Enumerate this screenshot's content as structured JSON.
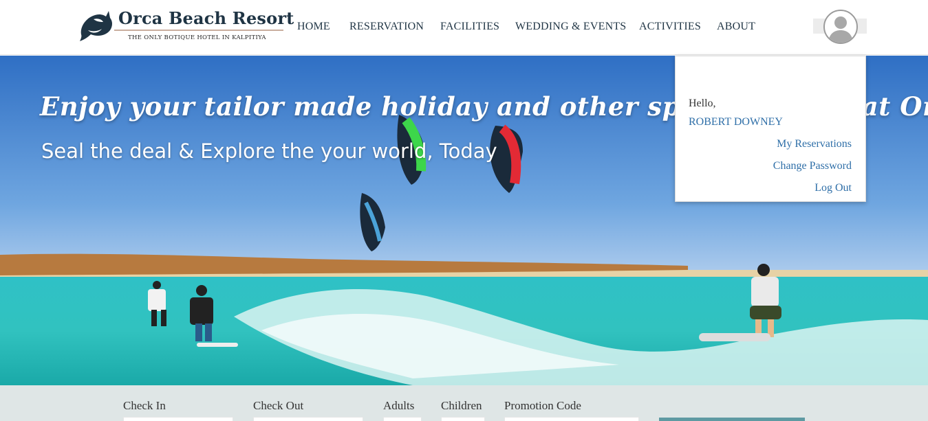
{
  "brand": {
    "name": "Orca Beach Resort",
    "tagline": "THE ONLY BOTIQUE HOTEL IN KALPITIYA"
  },
  "nav": {
    "items": [
      "HOME",
      "RESERVATION",
      "FACILITIES",
      "WEDDING & EVENTS",
      "ACTIVITIES",
      "ABOUT"
    ]
  },
  "hero": {
    "title": "Enjoy your tailor made holiday and other special events at Orca Beach Resort",
    "subtitle": "Seal the deal & Explore the your world, Today"
  },
  "user_menu": {
    "greeting": "Hello,",
    "user_name": "ROBERT DOWNEY",
    "links": [
      "My Reservations",
      "Change Password",
      "Log Out"
    ]
  },
  "booking": {
    "check_in_label": "Check In",
    "check_out_label": "Check Out",
    "adults_label": "Adults",
    "children_label": "Children",
    "promo_label": "Promotion Code"
  },
  "colors": {
    "brand_dark": "#1f3444",
    "link_blue": "#2f6fa8",
    "booking_bar": "#dfe6e6",
    "button_teal": "#5e9aa2"
  },
  "icons": {
    "logo": "orca-icon",
    "avatar": "user-avatar-icon"
  }
}
